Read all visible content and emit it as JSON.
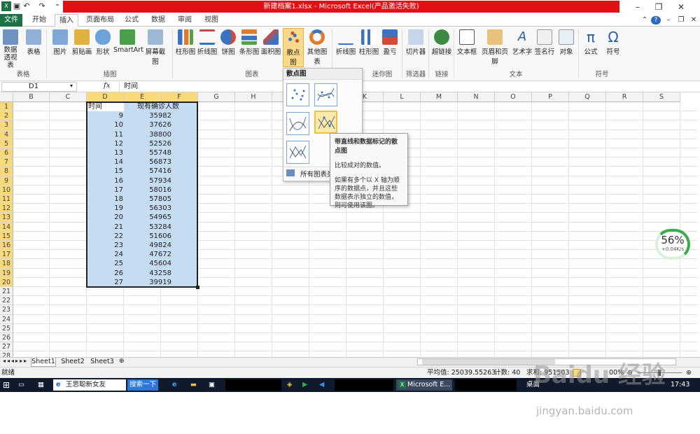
{
  "title": "新建档案1.xlsx - Microsoft Excel(产品激活失败)",
  "tabs": [
    "文件",
    "开始",
    "插入",
    "页面布局",
    "公式",
    "数据",
    "审阅",
    "视图"
  ],
  "ribbon": {
    "buttons": [
      "数据透视表",
      "表格",
      "图片",
      "剪贴画",
      "形状",
      "SmartArt",
      "屏幕截图",
      "柱形图",
      "折线图",
      "饼图",
      "条形图",
      "面积图",
      "散点图",
      "其他图表",
      "折线图",
      "柱形图",
      "盈亏",
      "切片器",
      "超链接",
      "文本框",
      "页眉和页脚",
      "艺术字",
      "签名行",
      "对象",
      "公式",
      "符号"
    ],
    "groups": [
      "表格",
      "插图",
      "图表",
      "迷你图",
      "筛选器",
      "链接",
      "文本",
      "符号"
    ]
  },
  "formula": {
    "name_box": "D1",
    "fx": "fx",
    "value": "时间"
  },
  "columns": [
    "B",
    "C",
    "D",
    "E",
    "F",
    "G",
    "H",
    "I",
    "J",
    "K",
    "L",
    "M",
    "N",
    "O",
    "P",
    "Q",
    "R",
    "S"
  ],
  "headers": {
    "d1": "时间",
    "e1": "现有确诊人数"
  },
  "rows": [
    [
      9,
      35982
    ],
    [
      10,
      37626
    ],
    [
      11,
      38800
    ],
    [
      12,
      52526
    ],
    [
      13,
      55748
    ],
    [
      14,
      56873
    ],
    [
      15,
      57416
    ],
    [
      16,
      57934
    ],
    [
      17,
      58016
    ],
    [
      18,
      57805
    ],
    [
      19,
      56303
    ],
    [
      20,
      54965
    ],
    [
      21,
      53284
    ],
    [
      22,
      51606
    ],
    [
      23,
      49824
    ],
    [
      24,
      47672
    ],
    [
      25,
      45604
    ],
    [
      26,
      43258
    ],
    [
      27,
      39919
    ]
  ],
  "row_numbers": [
    "1",
    "2",
    "3",
    "4",
    "5",
    "6",
    "7",
    "8",
    "9",
    "10",
    "11",
    "12",
    "13",
    "14",
    "15",
    "16",
    "17",
    "18",
    "19",
    "20",
    "21",
    "22",
    "23",
    "24",
    "25",
    "26",
    "27",
    "28",
    "29"
  ],
  "dropdown": {
    "title": "散点图",
    "all_types": "所有图表类型"
  },
  "tooltip": {
    "title": "带直线和数据标记的散点图",
    "line1": "比较成对的数值。",
    "line2": "如果有多个以 X 轴为顺序的数据点，并且这些数据表示独立的数值，则可使用该图。"
  },
  "sheets": [
    "Sheet1",
    "Sheet2",
    "Sheet3"
  ],
  "status": {
    "ready": "就绪",
    "average": "平均值: 25039.55263",
    "count": "计数: 40",
    "sum": "求和: 951503",
    "zoom": "00%"
  },
  "speed": {
    "percent": "56%",
    "rate": "+0.04K/s"
  },
  "taskbar": {
    "item1": "王思聪新女友",
    "search": "搜索一下",
    "excel": "Microsoft E...",
    "desktop": "桌面",
    "time": "17:43"
  },
  "watermark": {
    "brand": "Baidu 经验",
    "url": "jingyan.baidu.com"
  }
}
